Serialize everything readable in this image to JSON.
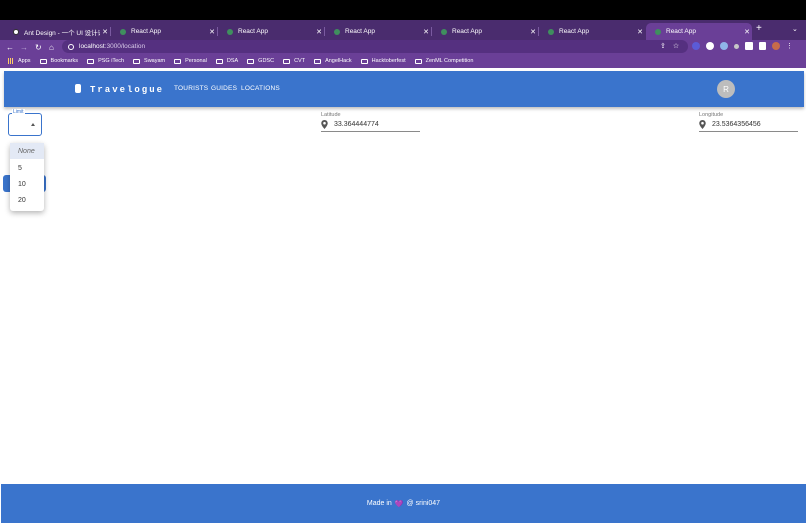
{
  "browser": {
    "tabs": [
      {
        "label": "Ant Design - 一个 UI 设计语言",
        "active": false
      },
      {
        "label": "React App",
        "active": false
      },
      {
        "label": "React App",
        "active": false
      },
      {
        "label": "React App",
        "active": false
      },
      {
        "label": "React App",
        "active": false
      },
      {
        "label": "React App",
        "active": false
      },
      {
        "label": "React App",
        "active": true
      }
    ],
    "address": {
      "host": "localhost",
      "path": ":3000/location"
    },
    "bookmarks": [
      "Apps",
      "Bookmarks",
      "PSG iTech",
      "Swayam",
      "Personal",
      "DSA",
      "GDSC",
      "CVT",
      "AngelHack",
      "Hacktoberfest",
      "ZenML Competition"
    ]
  },
  "app": {
    "brand": "Travelogue",
    "nav": [
      "TOURISTS",
      "GUIDES",
      "LOCATIONS"
    ],
    "avatar_letter": "R"
  },
  "limit": {
    "label": "Limit",
    "options": [
      "None",
      "5",
      "10",
      "20"
    ]
  },
  "latitude": {
    "label": "Latitude",
    "value": "33.364444774"
  },
  "longitude": {
    "label": "Longitude",
    "value": "23.5364356456"
  },
  "footer": {
    "prefix": "Made in",
    "heart": "💜",
    "suffix": "@ srini047"
  },
  "colors": {
    "primary": "#3a74cc",
    "browser_frame": "#6a3f97"
  }
}
